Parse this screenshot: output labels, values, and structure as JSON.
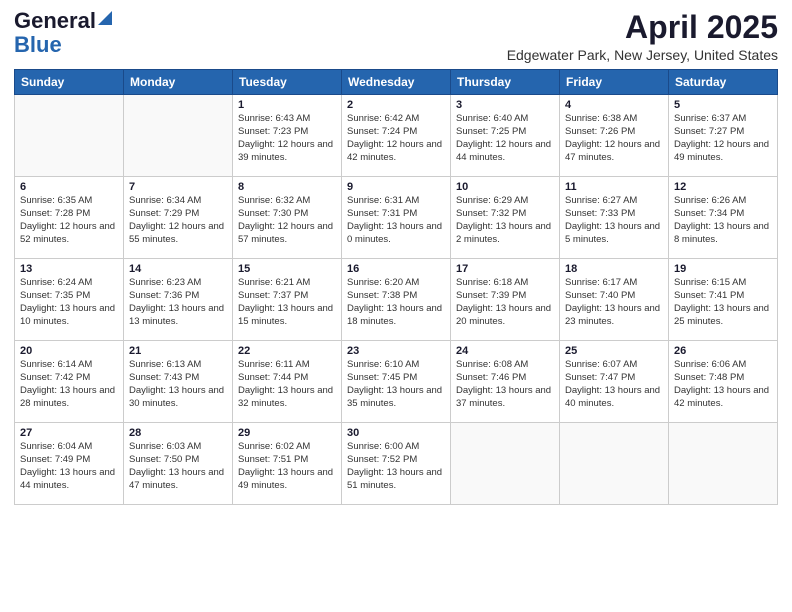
{
  "header": {
    "logo_line1": "General",
    "logo_line2": "Blue",
    "title": "April 2025",
    "subtitle": "Edgewater Park, New Jersey, United States"
  },
  "weekdays": [
    "Sunday",
    "Monday",
    "Tuesday",
    "Wednesday",
    "Thursday",
    "Friday",
    "Saturday"
  ],
  "weeks": [
    [
      {
        "day": "",
        "info": ""
      },
      {
        "day": "",
        "info": ""
      },
      {
        "day": "1",
        "info": "Sunrise: 6:43 AM\nSunset: 7:23 PM\nDaylight: 12 hours and 39 minutes."
      },
      {
        "day": "2",
        "info": "Sunrise: 6:42 AM\nSunset: 7:24 PM\nDaylight: 12 hours and 42 minutes."
      },
      {
        "day": "3",
        "info": "Sunrise: 6:40 AM\nSunset: 7:25 PM\nDaylight: 12 hours and 44 minutes."
      },
      {
        "day": "4",
        "info": "Sunrise: 6:38 AM\nSunset: 7:26 PM\nDaylight: 12 hours and 47 minutes."
      },
      {
        "day": "5",
        "info": "Sunrise: 6:37 AM\nSunset: 7:27 PM\nDaylight: 12 hours and 49 minutes."
      }
    ],
    [
      {
        "day": "6",
        "info": "Sunrise: 6:35 AM\nSunset: 7:28 PM\nDaylight: 12 hours and 52 minutes."
      },
      {
        "day": "7",
        "info": "Sunrise: 6:34 AM\nSunset: 7:29 PM\nDaylight: 12 hours and 55 minutes."
      },
      {
        "day": "8",
        "info": "Sunrise: 6:32 AM\nSunset: 7:30 PM\nDaylight: 12 hours and 57 minutes."
      },
      {
        "day": "9",
        "info": "Sunrise: 6:31 AM\nSunset: 7:31 PM\nDaylight: 13 hours and 0 minutes."
      },
      {
        "day": "10",
        "info": "Sunrise: 6:29 AM\nSunset: 7:32 PM\nDaylight: 13 hours and 2 minutes."
      },
      {
        "day": "11",
        "info": "Sunrise: 6:27 AM\nSunset: 7:33 PM\nDaylight: 13 hours and 5 minutes."
      },
      {
        "day": "12",
        "info": "Sunrise: 6:26 AM\nSunset: 7:34 PM\nDaylight: 13 hours and 8 minutes."
      }
    ],
    [
      {
        "day": "13",
        "info": "Sunrise: 6:24 AM\nSunset: 7:35 PM\nDaylight: 13 hours and 10 minutes."
      },
      {
        "day": "14",
        "info": "Sunrise: 6:23 AM\nSunset: 7:36 PM\nDaylight: 13 hours and 13 minutes."
      },
      {
        "day": "15",
        "info": "Sunrise: 6:21 AM\nSunset: 7:37 PM\nDaylight: 13 hours and 15 minutes."
      },
      {
        "day": "16",
        "info": "Sunrise: 6:20 AM\nSunset: 7:38 PM\nDaylight: 13 hours and 18 minutes."
      },
      {
        "day": "17",
        "info": "Sunrise: 6:18 AM\nSunset: 7:39 PM\nDaylight: 13 hours and 20 minutes."
      },
      {
        "day": "18",
        "info": "Sunrise: 6:17 AM\nSunset: 7:40 PM\nDaylight: 13 hours and 23 minutes."
      },
      {
        "day": "19",
        "info": "Sunrise: 6:15 AM\nSunset: 7:41 PM\nDaylight: 13 hours and 25 minutes."
      }
    ],
    [
      {
        "day": "20",
        "info": "Sunrise: 6:14 AM\nSunset: 7:42 PM\nDaylight: 13 hours and 28 minutes."
      },
      {
        "day": "21",
        "info": "Sunrise: 6:13 AM\nSunset: 7:43 PM\nDaylight: 13 hours and 30 minutes."
      },
      {
        "day": "22",
        "info": "Sunrise: 6:11 AM\nSunset: 7:44 PM\nDaylight: 13 hours and 32 minutes."
      },
      {
        "day": "23",
        "info": "Sunrise: 6:10 AM\nSunset: 7:45 PM\nDaylight: 13 hours and 35 minutes."
      },
      {
        "day": "24",
        "info": "Sunrise: 6:08 AM\nSunset: 7:46 PM\nDaylight: 13 hours and 37 minutes."
      },
      {
        "day": "25",
        "info": "Sunrise: 6:07 AM\nSunset: 7:47 PM\nDaylight: 13 hours and 40 minutes."
      },
      {
        "day": "26",
        "info": "Sunrise: 6:06 AM\nSunset: 7:48 PM\nDaylight: 13 hours and 42 minutes."
      }
    ],
    [
      {
        "day": "27",
        "info": "Sunrise: 6:04 AM\nSunset: 7:49 PM\nDaylight: 13 hours and 44 minutes."
      },
      {
        "day": "28",
        "info": "Sunrise: 6:03 AM\nSunset: 7:50 PM\nDaylight: 13 hours and 47 minutes."
      },
      {
        "day": "29",
        "info": "Sunrise: 6:02 AM\nSunset: 7:51 PM\nDaylight: 13 hours and 49 minutes."
      },
      {
        "day": "30",
        "info": "Sunrise: 6:00 AM\nSunset: 7:52 PM\nDaylight: 13 hours and 51 minutes."
      },
      {
        "day": "",
        "info": ""
      },
      {
        "day": "",
        "info": ""
      },
      {
        "day": "",
        "info": ""
      }
    ]
  ]
}
